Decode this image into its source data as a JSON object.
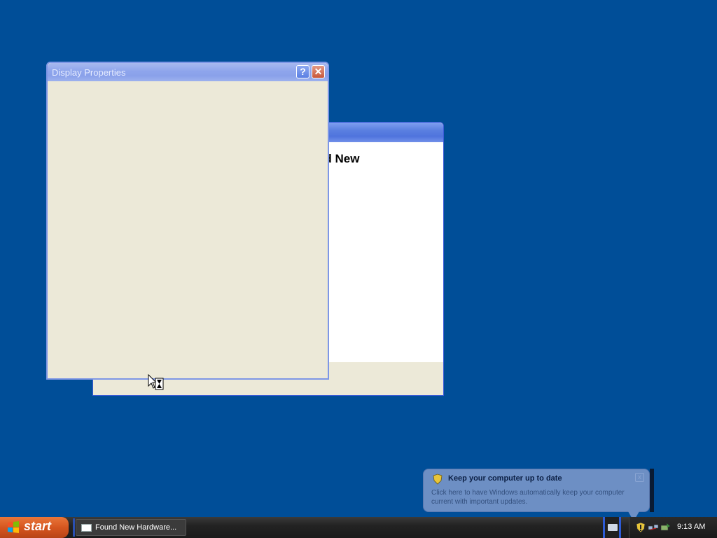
{
  "display_properties": {
    "title": "Display Properties",
    "help_label": "?",
    "close_label": "✕"
  },
  "hardware_wizard": {
    "heading_fragment": "nd New"
  },
  "notification": {
    "title": "Keep your computer up to date",
    "text": "Click here to have Windows automatically keep your computer current with important updates.",
    "close_label": "x"
  },
  "taskbar": {
    "start_label": "start",
    "task_label": "Found New Hardware...",
    "clock": "9:13 AM"
  },
  "colors": {
    "desktop": "#004e98",
    "window_body": "#ece9d8",
    "titlebar_inactive": "#8ea5ec",
    "start_orange": "#d6561f"
  }
}
